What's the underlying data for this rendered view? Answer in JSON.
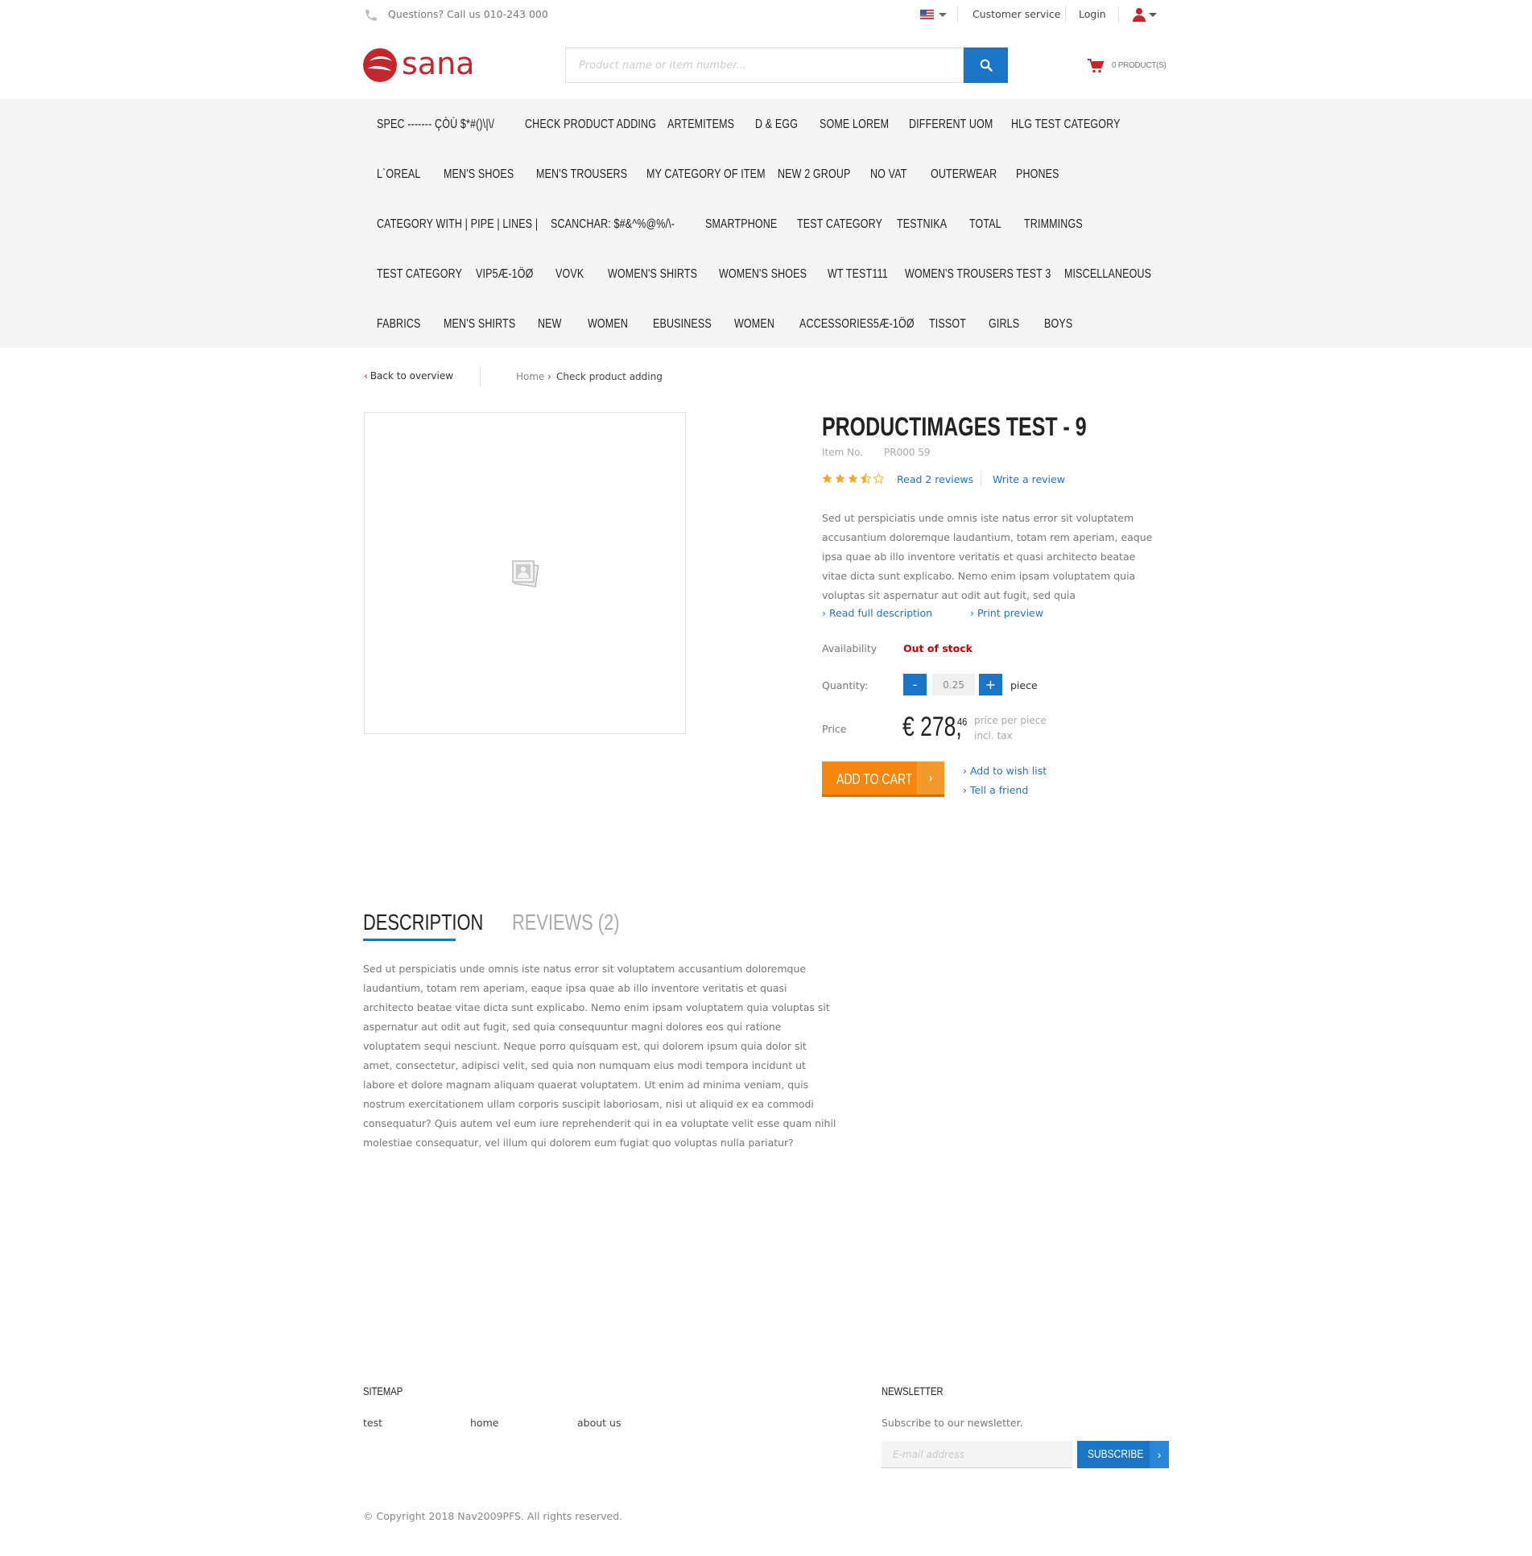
{
  "topbar": {
    "phone_icon": "phone-icon",
    "questions": "Questions? Call us 010-243 000",
    "customer_service": "Customer service",
    "login": "Login"
  },
  "header": {
    "logo_text": "sana",
    "brand_color": "#c4262e",
    "search_placeholder": "Product name or item number...",
    "cart_text": "0 PRODUCT(S)"
  },
  "nav": {
    "rows": [
      [
        "SPEC ------- ÇÒÙ $*#()\\|\\/",
        "CHECK PRODUCT ADDING",
        "ARTEMITEMS",
        "D & EGG",
        "SOME LOREM",
        "DIFFERENT UOM",
        "HLG TEST CATEGORY"
      ],
      [
        "L`OREAL",
        "MEN'S SHOES",
        "MEN'S TROUSERS",
        "MY CATEGORY OF ITEM",
        "NEW 2 GROUP",
        "NO VAT",
        "OUTERWEAR",
        "PHONES"
      ],
      [
        "CATEGORY WITH | PIPE | LINES |",
        "SCANCHAR: $#&^%@%/\\-",
        "SMARTPHONE",
        "TEST CATEGORY",
        "TESTNIKA",
        "TOTAL",
        "TRIMMINGS"
      ],
      [
        "TEST CATEGORY",
        "VIP5Æ-1ÖØ",
        "VOVK",
        "WOMEN'S SHIRTS",
        "WOMEN'S SHOES",
        "WT TEST111",
        "WOMEN'S TROUSERS TEST 3",
        "MISCELLANEOUS"
      ],
      [
        "FABRICS",
        "MEN'S SHIRTS",
        "NEW",
        "WOMEN",
        "EBUSINESS",
        "WOMEN",
        "ACCESSORIES5Æ-1ÖØ",
        "TISSOT",
        "GIRLS",
        "BOYS"
      ]
    ]
  },
  "breadcrumb": {
    "back": "Back to overview",
    "home": "Home",
    "current": "Check product adding"
  },
  "product": {
    "title": "PRODUCTIMAGES TEST - 9",
    "item_no_label": "Item No.",
    "item_no": "PR000 59",
    "rating": 3.5,
    "read_reviews": "Read 2 reviews",
    "write_review": "Write a review",
    "short_description": "Sed ut perspiciatis unde omnis iste natus error sit voluptatem accusantium doloremque laudantium, totam rem aperiam, eaque ipsa quae ab illo inventore veritatis et quasi architecto beatae vitae dicta sunt explicabo. Nemo enim ipsam voluptatem quia voluptas sit aspernatur aut odit aut fugit, sed quia",
    "read_full": "› Read full description",
    "print_preview": "› Print preview",
    "availability_label": "Availability",
    "availability": "Out of stock",
    "quantity_label": "Quantity:",
    "quantity": "0.25",
    "minus": "-",
    "plus": "+",
    "unit": "piece",
    "price_label": "Price",
    "price_main": "€ 278,",
    "price_cents": "46",
    "price_note1": "price per piece",
    "price_note2": "incl. tax",
    "add_to_cart": "ADD TO CART",
    "add_to_wishlist": "› Add to wish list",
    "tell_friend": "› Tell a friend"
  },
  "tabs": {
    "description": "DESCRIPTION",
    "reviews": "REVIEWS (2)"
  },
  "long_description": "Sed ut perspiciatis unde omnis iste natus error sit voluptatem accusantium doloremque laudantium, totam rem aperiam, eaque ipsa quae ab illo inventore veritatis et quasi architecto beatae vitae dicta sunt explicabo. Nemo enim ipsam voluptatem quia voluptas sit aspernatur aut odit aut fugit, sed quia consequuntur magni dolores eos qui ratione voluptatem sequi nesciunt. Neque porro quisquam est, qui dolorem ipsum quia dolor sit amet, consectetur, adipisci velit, sed quia non numquam eius modi tempora incidunt ut labore et dolore magnam aliquam quaerat voluptatem. Ut enim ad minima veniam, quis nostrum exercitationem ullam corporis suscipit laboriosam, nisi ut aliquid ex ea commodi consequatur? Quis autem vel eum iure reprehenderit qui in ea voluptate velit esse quam nihil molestiae consequatur, vel illum qui dolorem eum fugiat quo voluptas nulla pariatur?",
  "footer": {
    "sitemap": "SITEMAP",
    "links": [
      "test",
      "home",
      "about us"
    ],
    "newsletter": "NEWSLETTER",
    "newsletter_text": "Subscribe to our newsletter.",
    "email_placeholder": "E-mail address",
    "subscribe": "SUBSCRIBE",
    "copyright": "© Copyright 2018 Nav2009PFS. All rights reserved."
  }
}
